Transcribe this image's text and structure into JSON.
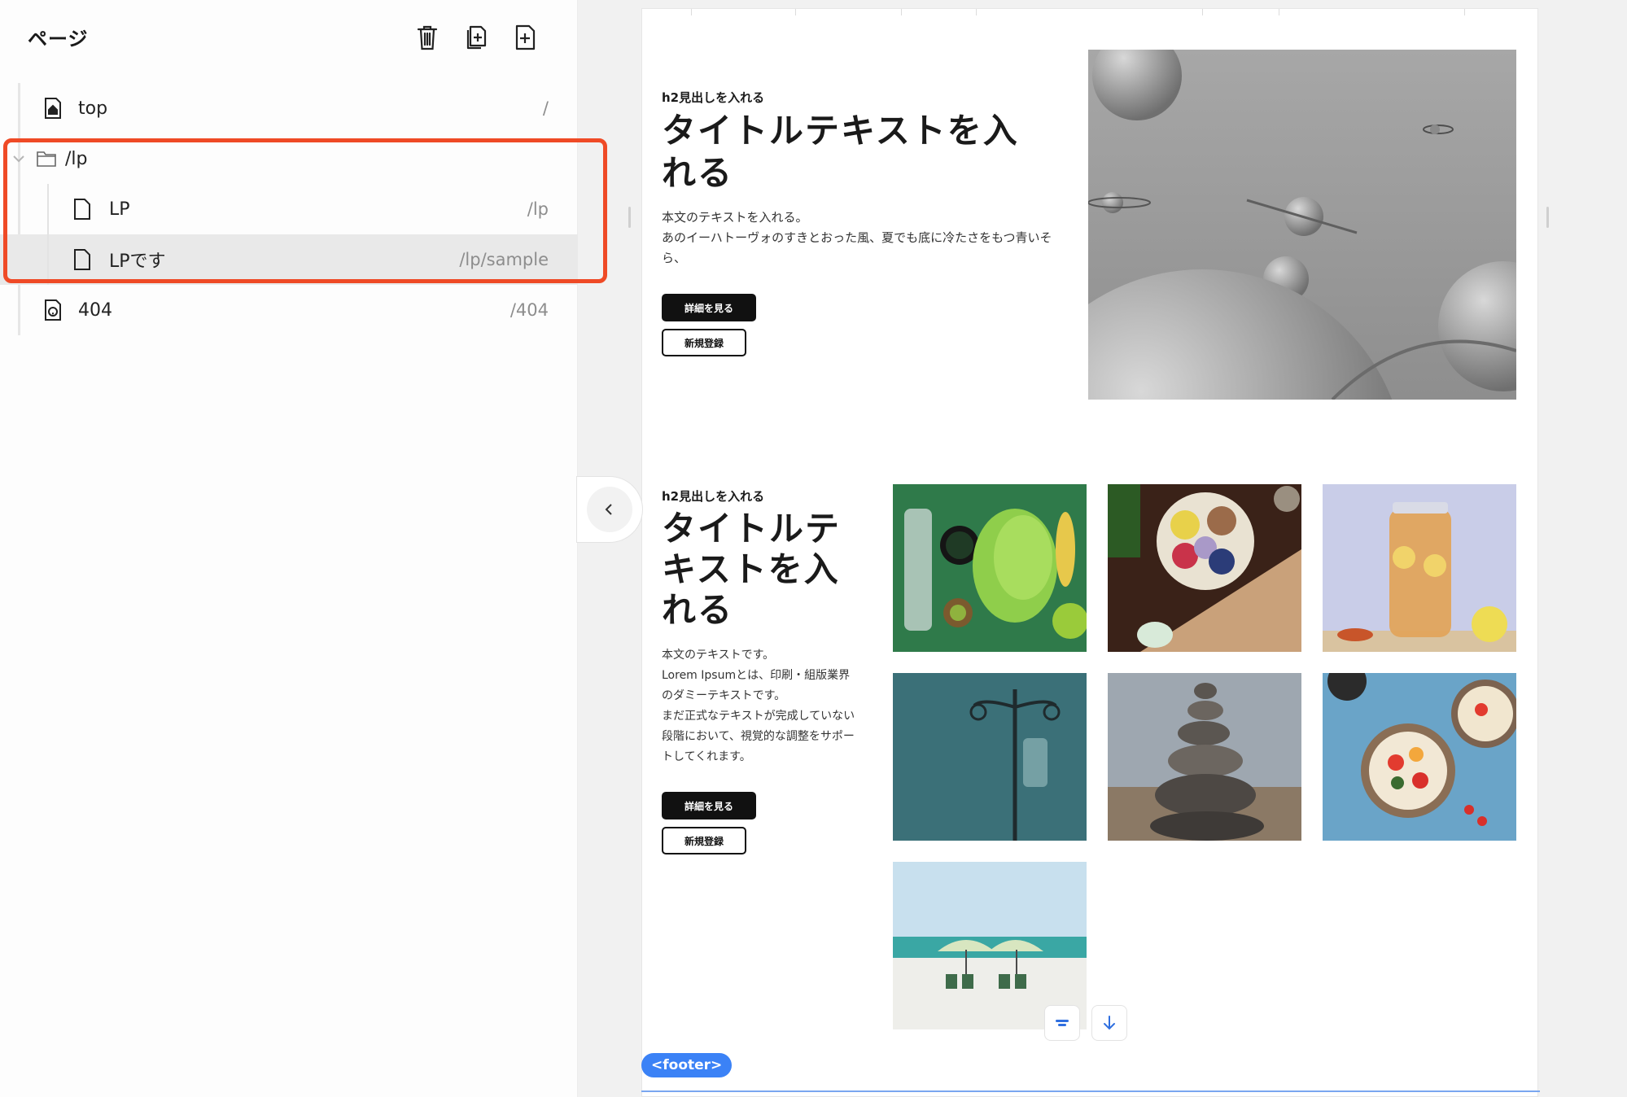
{
  "sidebar": {
    "title": "ページ",
    "tools": [
      {
        "name": "delete",
        "icon": "trash-icon"
      },
      {
        "name": "duplicate",
        "icon": "duplicate-page-icon"
      },
      {
        "name": "add",
        "icon": "add-page-icon"
      }
    ],
    "tree": {
      "top": {
        "label": "top",
        "path": "/",
        "icon": "home-page-icon"
      },
      "folder": {
        "label": "/lp",
        "icon": "folder-icon",
        "expanded": true
      },
      "children": [
        {
          "label": "LP",
          "path": "/lp",
          "icon": "page-icon"
        },
        {
          "label": "LPです",
          "path": "/lp/sample",
          "icon": "page-icon",
          "selected": true
        }
      ],
      "notfound": {
        "label": "404",
        "path": "/404",
        "icon": "help-page-icon"
      }
    },
    "highlight_color": "#ef4a26"
  },
  "canvas": {
    "section1": {
      "subheading": "h2見出しを入れる",
      "title": "タイトルテキストを入れる",
      "body_line1": "本文のテキストを入れる。",
      "body_line2": "あのイーハトーヴォのすきとおった風、夏でも底に冷たさをもつ青いそら、",
      "primary_button": "詳細を見る",
      "secondary_button": "新規登録"
    },
    "section2": {
      "subheading": "h2見出しを入れる",
      "title": "タイトルテキストを入れる",
      "body_line1": "本文のテキストです。",
      "body_line2": "Lorem Ipsumとは、印刷・組版業界のダミーテキストです。",
      "body_line3": "まだ正式なテキストが完成していない段階において、視覚的な調整をサポートしてくれます。",
      "primary_button": "詳細を見る",
      "secondary_button": "新規登録"
    },
    "footer_tag": "<footer>",
    "accent_color": "#3b82f6"
  }
}
